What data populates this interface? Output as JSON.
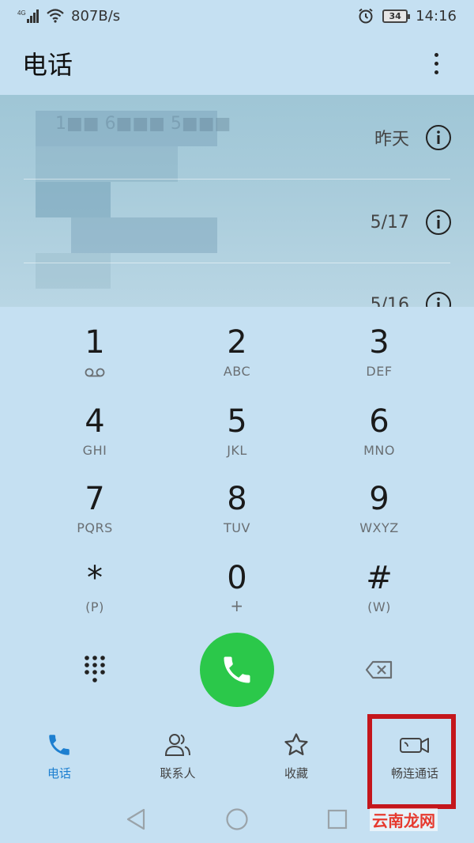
{
  "status_bar": {
    "network_type": "4G",
    "speed": "807B/s",
    "battery_level": "34",
    "time": "14:16",
    "icons": [
      "signal-icon",
      "wifi-icon",
      "alarm-icon",
      "battery-icon"
    ]
  },
  "app_bar": {
    "title": "电话",
    "more_icon": "more-vert-icon"
  },
  "call_log": {
    "entries": [
      {
        "number": "1■■ 6■■■ 5■■■",
        "date": "昨天"
      },
      {
        "number": "",
        "date": "5/17"
      },
      {
        "number": "",
        "date": "5/16"
      }
    ]
  },
  "dialpad": {
    "keys": [
      {
        "digit": "1",
        "letters": ""
      },
      {
        "digit": "2",
        "letters": "ABC"
      },
      {
        "digit": "3",
        "letters": "DEF"
      },
      {
        "digit": "4",
        "letters": "GHI"
      },
      {
        "digit": "5",
        "letters": "JKL"
      },
      {
        "digit": "6",
        "letters": "MNO"
      },
      {
        "digit": "7",
        "letters": "PQRS"
      },
      {
        "digit": "8",
        "letters": "TUV"
      },
      {
        "digit": "9",
        "letters": "WXYZ"
      },
      {
        "digit": "*",
        "letters": "(P)"
      },
      {
        "digit": "0",
        "letters": "+"
      },
      {
        "digit": "#",
        "letters": "(W)"
      }
    ]
  },
  "actions": {
    "call_color": "#2bc84a"
  },
  "tabs": [
    {
      "label": "电话",
      "icon": "phone-icon",
      "active": true
    },
    {
      "label": "联系人",
      "icon": "contacts-icon",
      "active": false
    },
    {
      "label": "收藏",
      "icon": "star-icon",
      "active": false
    },
    {
      "label": "畅连通话",
      "icon": "video-call-icon",
      "active": false
    }
  ],
  "watermark": "云南龙网",
  "colors": {
    "background": "#c5e0f2",
    "accent": "#1d7fd0",
    "highlight": "#c4161c"
  }
}
